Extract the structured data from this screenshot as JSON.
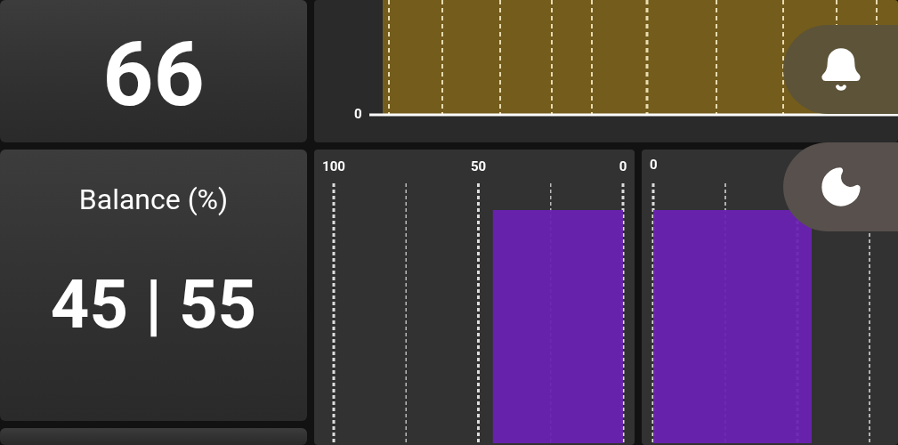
{
  "metrics": [
    {
      "value": "66"
    },
    {
      "title": "Balance (%)",
      "value": "45 | 55"
    }
  ],
  "power_chart": {
    "axis_label": "0"
  },
  "balance_left": {
    "chart_data": {
      "type": "bar",
      "orientation": "horizontal",
      "values": [
        45
      ],
      "xlim": [
        100,
        0
      ],
      "xticks": [
        100,
        50,
        0
      ]
    }
  },
  "balance_right": {
    "axis_label": "0"
  },
  "buttons": [
    {
      "kind": "bell"
    },
    {
      "kind": "moon"
    }
  ]
}
